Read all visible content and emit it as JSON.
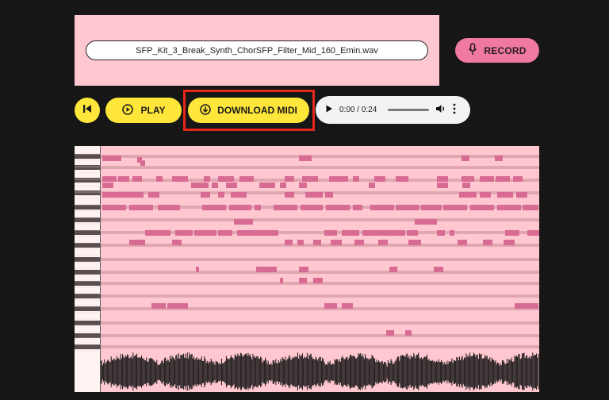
{
  "file": {
    "name": "SFP_Kit_3_Break_Synth_ChorSFP_Filter_Mid_160_Emin.wav"
  },
  "record": {
    "label": "RECORD",
    "icon": "microphone-icon"
  },
  "transport": {
    "skip_icon": "skip-back-icon",
    "play_label": "PLAY",
    "play_icon": "play-circle-icon",
    "download_label": "DOWNLOAD MIDI",
    "download_icon": "download-circle-icon"
  },
  "audio": {
    "time": "0:00 / 0:24",
    "progress": 0
  },
  "colors": {
    "background": "#161616",
    "panel": "#ffc8d0",
    "yellow_button": "#ffe63a",
    "record_button": "#f079a2",
    "note": "#d86b93",
    "highlight": "#e8261a"
  }
}
